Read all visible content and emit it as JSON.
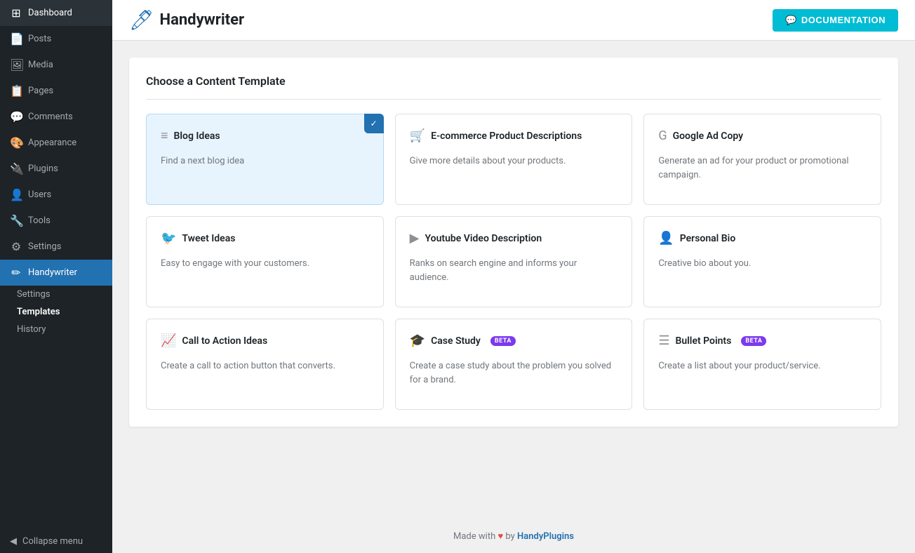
{
  "sidebar": {
    "items": [
      {
        "id": "dashboard",
        "label": "Dashboard",
        "icon": "⊞"
      },
      {
        "id": "posts",
        "label": "Posts",
        "icon": "📄"
      },
      {
        "id": "media",
        "label": "Media",
        "icon": "🖼"
      },
      {
        "id": "pages",
        "label": "Pages",
        "icon": "📋"
      },
      {
        "id": "comments",
        "label": "Comments",
        "icon": "💬"
      },
      {
        "id": "appearance",
        "label": "Appearance",
        "icon": "🎨"
      },
      {
        "id": "plugins",
        "label": "Plugins",
        "icon": "🔌"
      },
      {
        "id": "users",
        "label": "Users",
        "icon": "👤"
      },
      {
        "id": "tools",
        "label": "Tools",
        "icon": "🔧"
      },
      {
        "id": "settings",
        "label": "Settings",
        "icon": "⚙"
      },
      {
        "id": "handywriter",
        "label": "Handywriter",
        "icon": "✏"
      }
    ],
    "sub_items": [
      {
        "id": "sub-settings",
        "label": "Settings"
      },
      {
        "id": "sub-templates",
        "label": "Templates",
        "active": true
      },
      {
        "id": "sub-history",
        "label": "History"
      }
    ],
    "collapse_label": "Collapse menu"
  },
  "topbar": {
    "brand_name": "Handywriter",
    "doc_button_label": "DOCUMENTATION"
  },
  "main": {
    "section_title": "Choose a Content Template",
    "cards": [
      {
        "id": "blog-ideas",
        "title": "Blog Ideas",
        "desc": "Find a next blog idea",
        "icon": "≡",
        "selected": true,
        "beta": false
      },
      {
        "id": "ecommerce",
        "title": "E-commerce Product Descriptions",
        "desc": "Give more details about your products.",
        "icon": "🛒",
        "selected": false,
        "beta": false
      },
      {
        "id": "google-ad",
        "title": "Google Ad Copy",
        "desc": "Generate an ad for your product or promotional campaign.",
        "icon": "G",
        "selected": false,
        "beta": false
      },
      {
        "id": "tweet-ideas",
        "title": "Tweet Ideas",
        "desc": "Easy to engage with your customers.",
        "icon": "🐦",
        "selected": false,
        "beta": false
      },
      {
        "id": "youtube-desc",
        "title": "Youtube Video Description",
        "desc": "Ranks on search engine and informs your audience.",
        "icon": "▶",
        "selected": false,
        "beta": false
      },
      {
        "id": "personal-bio",
        "title": "Personal Bio",
        "desc": "Creative bio about you.",
        "icon": "👤",
        "selected": false,
        "beta": false
      },
      {
        "id": "cta-ideas",
        "title": "Call to Action Ideas",
        "desc": "Create a call to action button that converts.",
        "icon": "📈",
        "selected": false,
        "beta": false
      },
      {
        "id": "case-study",
        "title": "Case Study",
        "desc": "Create a case study about the problem you solved for a brand.",
        "icon": "🎓",
        "selected": false,
        "beta": true
      },
      {
        "id": "bullet-points",
        "title": "Bullet Points",
        "desc": "Create a list about your product/service.",
        "icon": "☰",
        "selected": false,
        "beta": true
      }
    ]
  },
  "footer": {
    "text": "Made with",
    "heart": "♥",
    "by": "by",
    "link_label": "HandyPlugins",
    "link_url": "#"
  }
}
